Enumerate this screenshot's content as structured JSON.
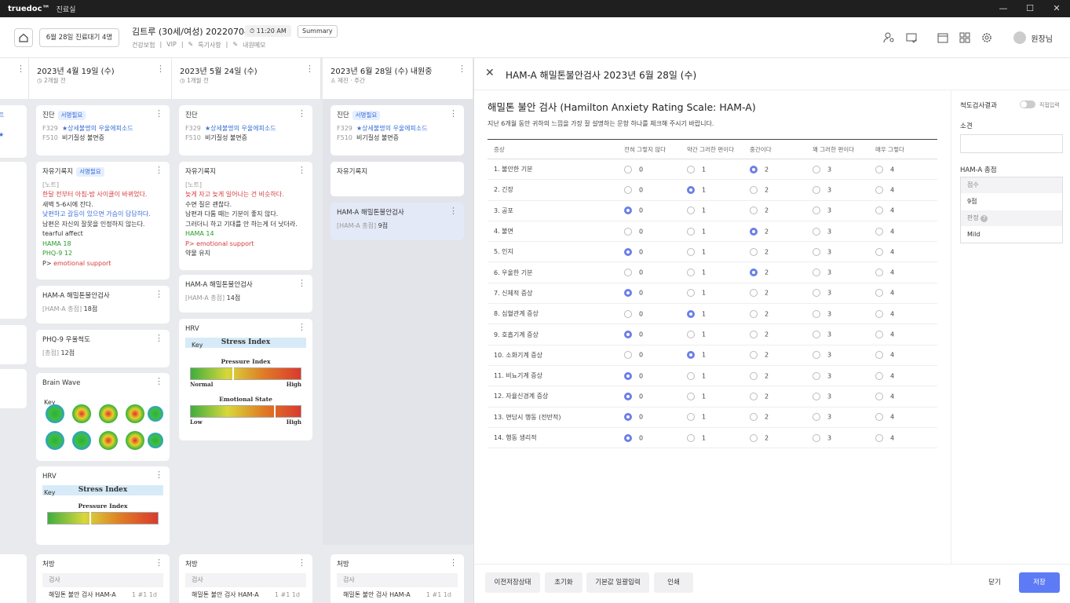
{
  "app": {
    "logo": "truedoc™",
    "title": "진료실"
  },
  "header": {
    "date_queue": "6월 28일 진료대기 4명",
    "patient": "김트루 (30세/여성) 2022070471",
    "time": "11:20 AM",
    "summary": "Summary",
    "insurance": "건강보험",
    "vip": "VIP",
    "special": "특기사항",
    "memo": "내원메모",
    "user": "원장님"
  },
  "columns": [
    {
      "date": "2023년 4월 19일 (수)",
      "ago": "2개월 전"
    },
    {
      "date": "2023년 5월 24일 (수)",
      "ago": "1개월 전"
    },
    {
      "date": "2023년 6월 28일 (수) 내원중",
      "type": "재진",
      "time": "주간"
    }
  ],
  "cards": {
    "diag_title": "진단",
    "sign_tag": "서명필요",
    "code1": "F329",
    "dx1": "상세불명의 우울에피소드",
    "code2": "F510",
    "dx2": "비기질성 불면증",
    "free_title": "자유기록지",
    "note_label": "[노트]",
    "c1_lines": [
      "한달 전부터 아침-밤 사이클이 바뀌었다.",
      "새벽 5-6시에 잔다.",
      "낮편하고 갈등이 있으면 가슴이 답답하다.",
      "남편은 자신의 잘못을 인정하지 않는다.",
      "tearful affect",
      "HAMA 18",
      "PHQ-9 12",
      "P>",
      "emotional support"
    ],
    "c2_lines": [
      "늦게 자고 늦게 일어나는 건 비슷하다.",
      "수면 질은 괜찮다.",
      "남편과 다툼 때는 기분이 좋지 않다.",
      "그러더니 하고 기대를 안 하는게 더 낫더라.",
      "HAMA 14",
      "P> emotional support",
      "약물 유지"
    ],
    "ham_title": "HAM-A 해밀톤불안검사",
    "ham_label": "[HAM-A 총점]",
    "ham1": "18점",
    "ham2": "14점",
    "ham3": "9점",
    "phq_title": "PHQ-9 우울척도",
    "phq_label": "[총점]",
    "phq": "12점",
    "brain_title": "Brain Wave",
    "hrv_title": "HRV",
    "key": "Key",
    "stress": "Stress Index",
    "pressure": "Pressure Index",
    "emotional": "Emotional State",
    "normal": "Normal",
    "high": "High",
    "low": "Low",
    "rx_title": "처방",
    "exam": "검사",
    "rx_item": "해밀톤 불안 검사 HAM-A",
    "rx_qty": "1 #1 1d"
  },
  "panel": {
    "title": "HAM-A  해밀톤불안검사 2023년 6월 28일 (수)",
    "heading": "해밀톤 불안 검사 (Hamilton Anxiety Rating Scale: HAM-A)",
    "desc": "지난 6개월 동안 귀하의 느낌을 가장 잘 설명하는 문항 하나를 체크해 주시기 바랍니다.",
    "col_symptom": "증상",
    "options": [
      "전혀 그렇지 않다",
      "약간 그러한 편이다",
      "중간이다",
      "꽤 그러한 편이다",
      "매우 그렇다"
    ],
    "items": [
      {
        "label": "1. 불안한 기분",
        "v": 2
      },
      {
        "label": "2. 긴장",
        "v": 1
      },
      {
        "label": "3. 공포",
        "v": 0
      },
      {
        "label": "4. 불면",
        "v": 2
      },
      {
        "label": "5. 인지",
        "v": 0
      },
      {
        "label": "6. 우울한 기분",
        "v": 2
      },
      {
        "label": "7. 신체적 증상",
        "v": 0
      },
      {
        "label": "8. 심혈관계 증상",
        "v": 1
      },
      {
        "label": "9. 호흡기계 증상",
        "v": 0
      },
      {
        "label": "10. 소화기계 증상",
        "v": 1
      },
      {
        "label": "11. 비뇨기계 증상",
        "v": 0
      },
      {
        "label": "12. 자율신경계 증상",
        "v": 0
      },
      {
        "label": "13. 면담시 행동 (전반적)",
        "v": 0
      },
      {
        "label": "14. 행동 생리적",
        "v": 0
      }
    ],
    "buttons": {
      "prev": "이전저장상태",
      "reset": "초기화",
      "default": "기본값 일괄입력",
      "print": "인쇄",
      "close": "닫기",
      "save": "저장"
    },
    "side": {
      "result": "척도검사결과",
      "direct": "직접입력",
      "finding": "소견",
      "total_title": "HAM-A 총점",
      "score_label": "점수",
      "score": "9점",
      "judge_label": "판정",
      "judge": "Mild"
    }
  }
}
